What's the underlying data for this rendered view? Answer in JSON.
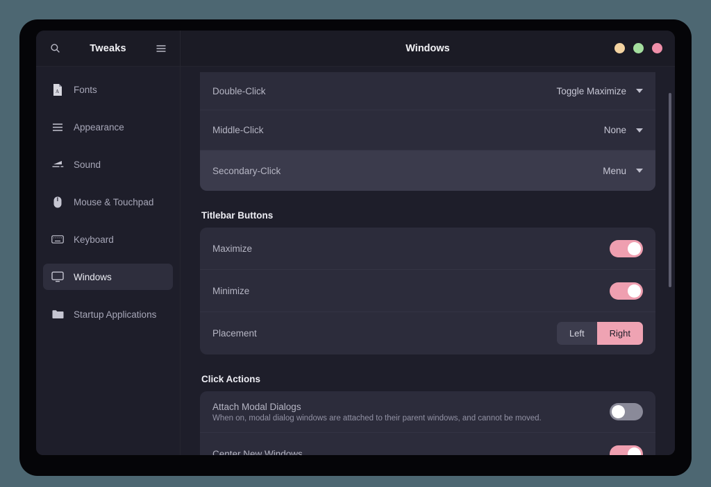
{
  "window": {
    "sidebar_title": "Tweaks",
    "content_title": "Windows",
    "search_icon": "search-icon",
    "menu_icon": "hamburger-menu-icon",
    "traffic_lights": [
      {
        "name": "minimize-button",
        "color": "#f3d3a1"
      },
      {
        "name": "maximize-button",
        "color": "#a4de9e"
      },
      {
        "name": "close-button",
        "color": "#ef8fa9"
      }
    ]
  },
  "sidebar": {
    "items": [
      {
        "label": "Fonts",
        "icon": "font-file-icon",
        "selected": false
      },
      {
        "label": "Appearance",
        "icon": "list-lines-icon",
        "selected": false
      },
      {
        "label": "Sound",
        "icon": "sound-wave-icon",
        "selected": false
      },
      {
        "label": "Mouse & Touchpad",
        "icon": "mouse-icon",
        "selected": false
      },
      {
        "label": "Keyboard",
        "icon": "keyboard-icon",
        "selected": false
      },
      {
        "label": "Windows",
        "icon": "monitor-icon",
        "selected": true
      },
      {
        "label": "Startup Applications",
        "icon": "folder-icon",
        "selected": false
      }
    ]
  },
  "content": {
    "click_rows": [
      {
        "label": "Double-Click",
        "value": "Toggle Maximize",
        "highlight": false
      },
      {
        "label": "Middle-Click",
        "value": "None",
        "highlight": false
      },
      {
        "label": "Secondary-Click",
        "value": "Menu",
        "highlight": true
      }
    ],
    "titlebar_buttons": {
      "heading": "Titlebar Buttons",
      "maximize": {
        "label": "Maximize",
        "state": "on"
      },
      "minimize": {
        "label": "Minimize",
        "state": "on"
      },
      "placement": {
        "label": "Placement",
        "options": [
          "Left",
          "Right"
        ],
        "selected": "Right"
      }
    },
    "click_actions": {
      "heading": "Click Actions",
      "attach_modal": {
        "label": "Attach Modal Dialogs",
        "description": "When on, modal dialog windows are attached to their parent windows, and cannot be moved.",
        "state": "off"
      },
      "center_new": {
        "label": "Center New Windows",
        "state": "on"
      }
    }
  },
  "colors": {
    "accent_pink": "#efa3b3",
    "page_background": "#4d6772",
    "window_background": "#1e1e2a",
    "card_background": "#2c2c3b"
  }
}
